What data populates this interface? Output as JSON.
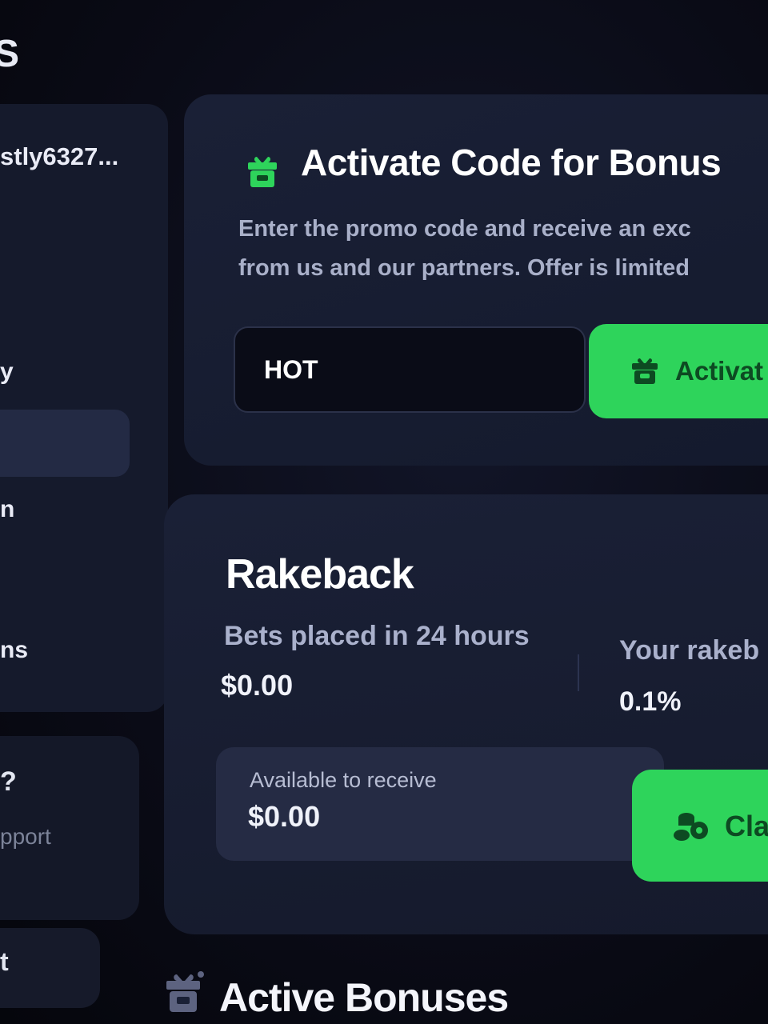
{
  "sidebar": {
    "title_fragment": "S",
    "username": "stly6327...",
    "item_fragments": [
      "y",
      "n",
      "ns"
    ],
    "support": {
      "question_fragment": "?",
      "link_fragment": "pport"
    },
    "bottom_fragment": "t"
  },
  "promo": {
    "title": "Activate Code for Bonus",
    "description_line1": "Enter the promo code and receive an exc",
    "description_line2": "from us and our partners. Offer is limited",
    "code_value": "HOT",
    "activate_label": "Activat",
    "icon": "gift-icon"
  },
  "rakeback": {
    "title": "Rakeback",
    "bets_label": "Bets placed in 24 hours",
    "bets_value": "$0.00",
    "rate_label": "Your rakeb",
    "rate_value": "0.1%",
    "available_label": "Available to receive",
    "available_value": "$0.00",
    "claim_label": "Cla",
    "claim_icon": "coins-icon"
  },
  "active_bonuses": {
    "title": "Active Bonuses",
    "icon": "gift-icon"
  },
  "colors": {
    "accent_green": "#2ed45b",
    "button_text": "#0d4a22",
    "card_bg": "#1a2036",
    "page_bg": "#07080f"
  }
}
